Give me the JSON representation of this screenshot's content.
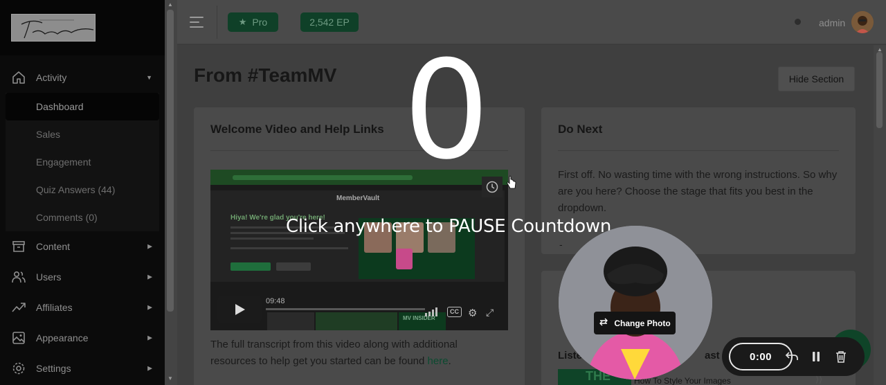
{
  "topbar": {
    "pro_label": "Pro",
    "ep_label": "2,542 EP",
    "admin_label": "admin"
  },
  "sidebar": {
    "items": [
      {
        "label": "Activity",
        "icon": "home-icon",
        "expanded": true
      },
      {
        "label": "Content",
        "icon": "archive-icon"
      },
      {
        "label": "Users",
        "icon": "users-icon"
      },
      {
        "label": "Affiliates",
        "icon": "trending-icon"
      },
      {
        "label": "Appearance",
        "icon": "image-icon"
      },
      {
        "label": "Settings",
        "icon": "gear-icon"
      }
    ],
    "sub_items": [
      {
        "label": "Dashboard",
        "active": true
      },
      {
        "label": "Sales"
      },
      {
        "label": "Engagement"
      },
      {
        "label": "Quiz Answers (44)"
      },
      {
        "label": "Comments (0)"
      }
    ]
  },
  "main": {
    "title": "From #TeamMV",
    "hide_section_label": "Hide Section",
    "welcome_card": {
      "title": "Welcome Video and Help Links",
      "transcript_text": "The full transcript from this video along with additional resources to help get you started can be found ",
      "link_text": "here",
      "after_link": "."
    },
    "video": {
      "timecode": "09:48",
      "headline": "Hiya! We're glad you're here!",
      "brand": "MemberVault",
      "thumbnail_label": "MV INSIDER"
    },
    "do_next_card": {
      "title": "Do Next",
      "text": "First off. No wasting time with the wrong instructions. So why are you here? Choose the stage that fits you best in the dropdown.",
      "select_value": "-"
    },
    "listen_card": {
      "label_left": "Liste",
      "label_right": "ast ep",
      "podcast_title": "How To Style Your Images",
      "thumbnail_text": "THE"
    }
  },
  "overlay": {
    "countdown": "0",
    "pause_message": "Click anywhere to PAUSE Countdown",
    "change_photo_label": "Change Photo",
    "timer": "0:00"
  },
  "colors": {
    "brand_green": "#0f4428",
    "overlay_text": "#ffffff"
  }
}
